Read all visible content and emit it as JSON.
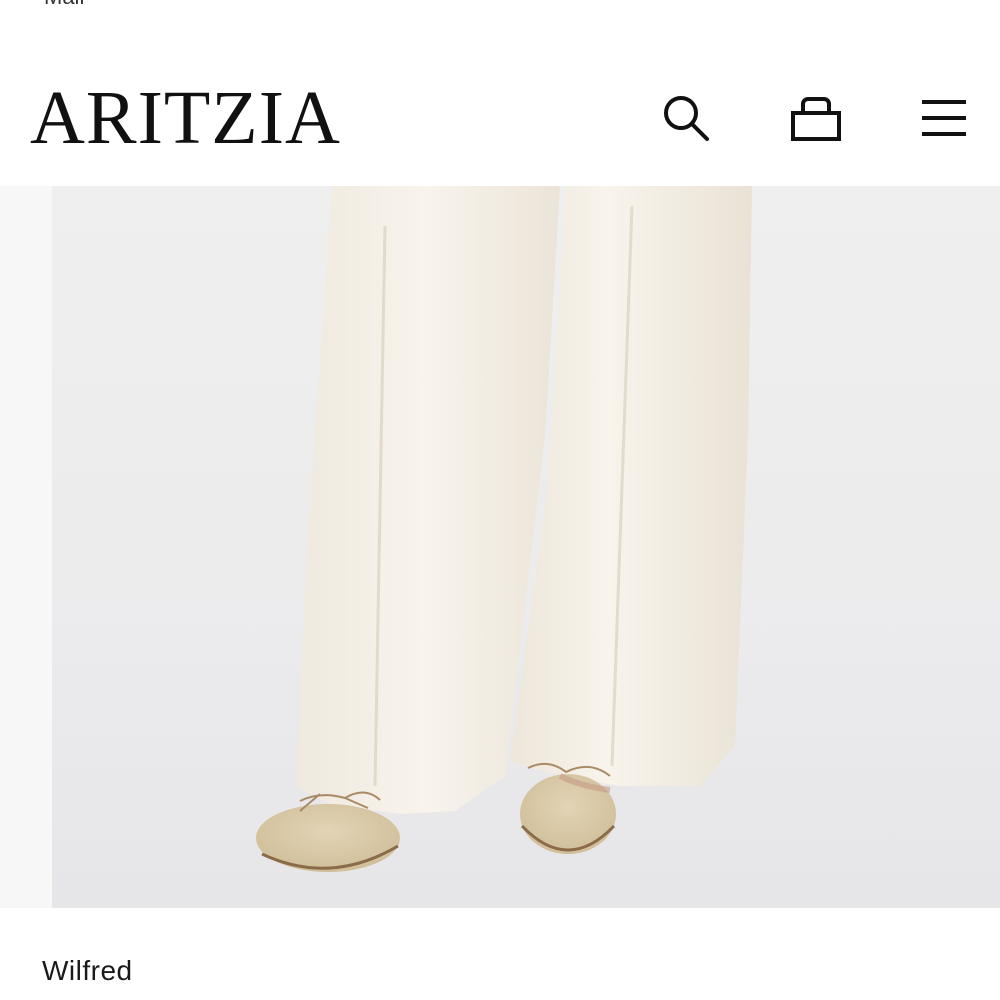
{
  "status_bar": {
    "partial_text": "Mail"
  },
  "header": {
    "logo": "ARITZIA",
    "search_icon": "search-icon",
    "bag_icon": "shopping-bag-icon",
    "menu_icon": "hamburger-menu-icon"
  },
  "product": {
    "image_alt": "model wearing cream wide-leg trousers with beige suede ballet flats",
    "name": "Wilfred"
  },
  "colors": {
    "background": "#ffffff",
    "text": "#111111",
    "image_backdrop": "#f0f0f0",
    "trouser": "#f6f1e8",
    "shoe": "#d8c8a6"
  }
}
